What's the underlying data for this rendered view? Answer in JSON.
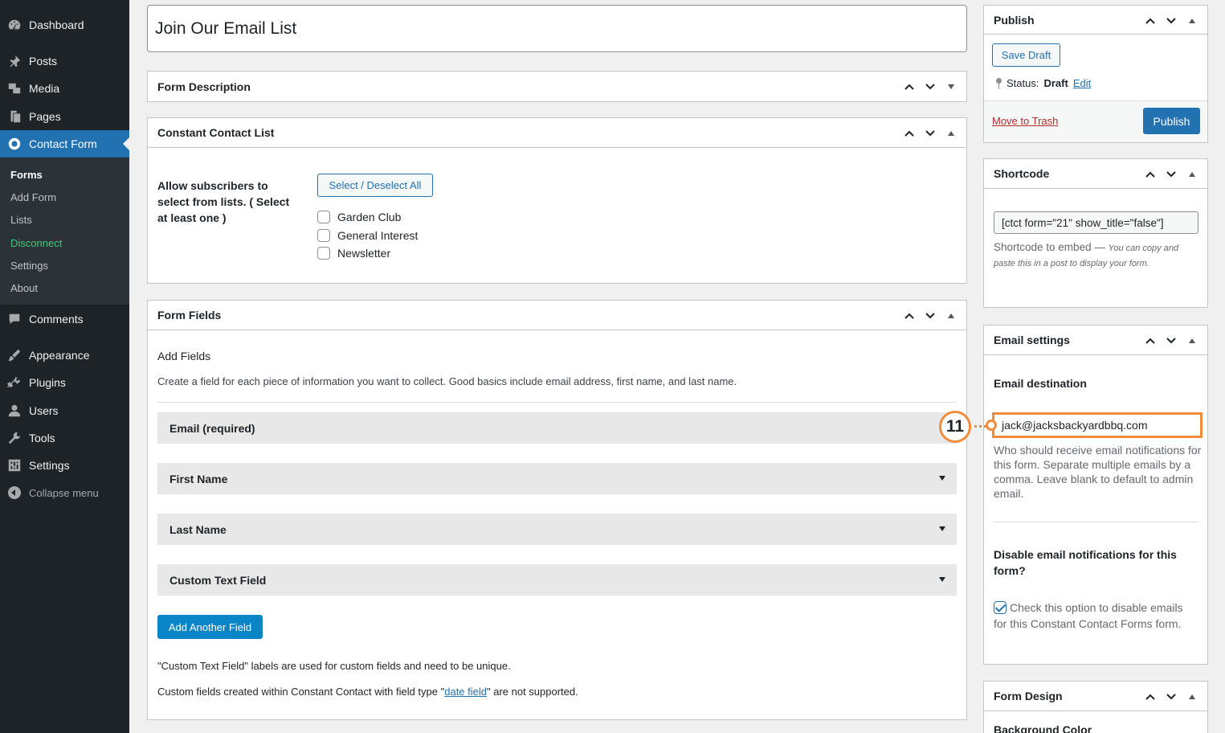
{
  "sidebar": {
    "items": [
      {
        "label": "Dashboard",
        "icon": "dashboard-icon"
      },
      {
        "label": "Posts",
        "icon": "pin-icon"
      },
      {
        "label": "Media",
        "icon": "media-icon"
      },
      {
        "label": "Pages",
        "icon": "pages-icon"
      },
      {
        "label": "Contact Form",
        "icon": "contact-form-icon"
      },
      {
        "label": "Comments",
        "icon": "comments-icon"
      },
      {
        "label": "Appearance",
        "icon": "brush-icon"
      },
      {
        "label": "Plugins",
        "icon": "plug-icon"
      },
      {
        "label": "Users",
        "icon": "user-icon"
      },
      {
        "label": "Tools",
        "icon": "wrench-icon"
      },
      {
        "label": "Settings",
        "icon": "settings-icon"
      }
    ],
    "submenu": [
      "Forms",
      "Add Form",
      "Lists",
      "Disconnect",
      "Settings",
      "About"
    ],
    "collapse": "Collapse menu"
  },
  "form_title": "Join Our Email List",
  "form_description": {
    "title": "Form Description"
  },
  "cc_list": {
    "title": "Constant Contact List",
    "label": "Allow subscribers to select from lists. ( Select at least one )",
    "select_all": "Select / Deselect All",
    "lists": [
      "Garden Club",
      "General Interest",
      "Newsletter"
    ]
  },
  "form_fields": {
    "title": "Form Fields",
    "add_fields": "Add Fields",
    "help": "Create a field for each piece of information you want to collect. Good basics include email address, first name, and last name.",
    "fields": [
      "Email (required)",
      "First Name",
      "Last Name",
      "Custom Text Field"
    ],
    "add_button": "Add Another Field",
    "note1": "\"Custom Text Field\" labels are used for custom fields and need to be unique.",
    "note2_prefix": "Custom fields created within Constant Contact with field type \"",
    "note2_link": "date field",
    "note2_suffix": "\" are not supported."
  },
  "publish": {
    "title": "Publish",
    "save_draft": "Save Draft",
    "status_label": "Status:",
    "status_value": "Draft",
    "edit": "Edit",
    "trash": "Move to Trash",
    "publish_button": "Publish"
  },
  "shortcode": {
    "title": "Shortcode",
    "value": "[ctct form=\"21\" show_title=\"false\"]",
    "help_prefix": "Shortcode to embed —",
    "help_italic": "You can copy and paste this in a post to display your form."
  },
  "email_settings": {
    "title": "Email settings",
    "destination_label": "Email destination",
    "destination_value": "jack@jacksbackyardbbq.com",
    "destination_help": "Who should receive email notifications for this form. Separate multiple emails by a comma. Leave blank to default to admin email.",
    "disable_label": "Disable email notifications for this form?",
    "disable_help": "Check this option to disable emails for this Constant Contact Forms form."
  },
  "annotation": {
    "number": "11",
    "color": "#f08c3c"
  },
  "form_design": {
    "title": "Form Design",
    "bg_label": "Background Color"
  },
  "colors": {
    "accent": "#2271b1",
    "sidebar": "#1d2327",
    "disconnect": "#3ec97a",
    "trash": "#b32d2e"
  }
}
